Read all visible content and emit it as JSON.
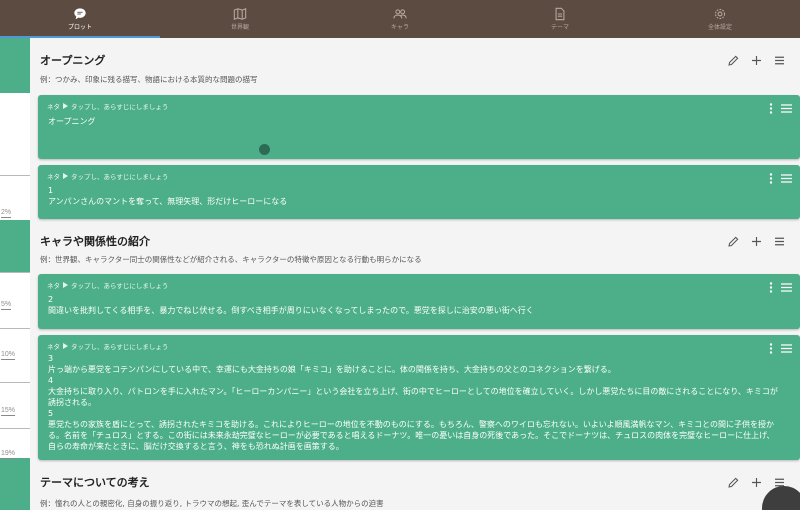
{
  "tabs": [
    {
      "label": "プロット",
      "icon": "chat-bubble-icon",
      "active": true
    },
    {
      "label": "世界観",
      "icon": "map-icon",
      "active": false
    },
    {
      "label": "キャラ",
      "icon": "people-icon",
      "active": false
    },
    {
      "label": "テーマ",
      "icon": "document-icon",
      "active": false
    },
    {
      "label": "全体設定",
      "icon": "gear-icon",
      "active": false
    }
  ],
  "rail": {
    "marks": [
      "2%",
      "5%",
      "10%",
      "15%",
      "19%"
    ]
  },
  "colors": {
    "topbar": "#5b4b41",
    "accent_green": "#4caf8a",
    "tab_indicator": "#4d9ad6"
  },
  "sections": [
    {
      "title": "オープニング",
      "description": "例：つかみ、印象に残る描写、物語における本質的な問題の描写",
      "cards": [
        {
          "meta": "ネタ",
          "hint": "タップし、あらすじにしましょう",
          "body": "オープニング"
        },
        {
          "meta": "ネタ",
          "hint": "タップし、あらすじにしましょう",
          "body": "1\nアンパンさんのマントを奪って、無理矢理、形だけヒーローになる"
        }
      ]
    },
    {
      "title": "キャラや関係性の紹介",
      "description": "例：世界観、キャラクター同士の関係性などが紹介される、キャラクターの特徴や原因となる行動も明らかになる",
      "cards": [
        {
          "meta": "ネタ",
          "hint": "タップし、あらすじにしましょう",
          "body": "2\n間違いを批判してくる相手を、暴力でねじ伏せる。倒すべき相手が周りにいなくなってしまったので。悪党を探しに治安の悪い街へ行く"
        },
        {
          "meta": "ネタ",
          "hint": "タップし、あらすじにしましょう",
          "body": "3\n片っ端から悪党をコテンパンにしている中で、幸運にも大金持ちの娘「キミコ」を助けることに。体の関係を持ち、大金持ちの父とのコネクションを繋げる。\n4\n大金持ちに取り入り、パトロンを手に入れたマン。「ヒーローカンパニー」という会社を立ち上げ、街の中でヒーローとしての地位を確立していく。しかし悪党たちに目の敵にされることになり、キミコが誘拐される。\n5\n悪党たちの家族を盾にとって、誘拐されたキミコを助ける。これによりヒーローの地位を不動のものにする。もちろん、警察へのワイロも忘れない。いよいよ順風満帆なマン、キミコとの間に子供を授かる。名前を「チュロス」とする。この街には未来永劫完璧なヒーローが必要であると唱えるドーナツ。唯一の憂いは自身の死後であった。そこでドーナツは、チュロスの肉体を完璧なヒーローに仕上げ、自らの寿命が来たときに、脳だけ交換すると言う、神をも恐れぬ計画を画策する。"
        }
      ]
    },
    {
      "title": "テーマについての考え",
      "description": "例：憧れの人との親密化, 自身の振り返り, トラウマの想起, 歪んでテーマを表している人物からの迫害",
      "cards": []
    }
  ]
}
